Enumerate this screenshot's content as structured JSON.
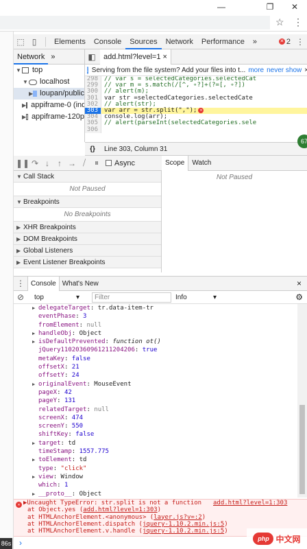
{
  "window": {
    "minimize": "—",
    "restore": "❐",
    "close": "✕"
  },
  "address": {
    "star": "☆",
    "menu": "⋮"
  },
  "devtools": {
    "tabs": [
      "Elements",
      "Console",
      "Sources",
      "Network",
      "Performance"
    ],
    "active_tab": "Sources",
    "more": "»",
    "error_count": "2",
    "menu": "⋮"
  },
  "navigator": {
    "tab": "Network",
    "more": "»",
    "items": [
      {
        "label": "top",
        "arrow": "▼"
      },
      {
        "label": "localhost",
        "arrow": "▼"
      },
      {
        "label": "loupan/public",
        "arrow": "▶"
      },
      {
        "label": "appiframe-0 (ind",
        "arrow": "▶"
      },
      {
        "label": "appiframe-120p",
        "arrow": "▶"
      }
    ]
  },
  "editor": {
    "file_tab": "add.html?level=1",
    "close": "×",
    "info_text": "Serving from the file system? Add your files into t...",
    "info_more": "more",
    "info_never": "never show",
    "info_close": "×",
    "lines": [
      {
        "num": "298",
        "text": "//              var s = selectedCategories.selectedCat",
        "comment": true
      },
      {
        "num": "299",
        "text": "//              var m = s.match(/[^, ∘?]+(?=[, ∘?])",
        "comment": true
      },
      {
        "num": "300",
        "text": "//              alert(m);",
        "comment": true
      },
      {
        "num": "301",
        "text": "              var str =selectedCategories.selectedCate",
        "comment": false
      },
      {
        "num": "302",
        "text": "//              alert(str);",
        "comment": true
      },
      {
        "num": "303",
        "text": "              var arr = str.split(\",\");",
        "comment": false,
        "highlight": true
      },
      {
        "num": "304",
        "text": "              console.log(arr);",
        "comment": false
      },
      {
        "num": "305",
        "text": "//              alert(parseInt(selectedCategories.sele",
        "comment": true
      },
      {
        "num": "306",
        "text": "",
        "comment": false
      }
    ],
    "status": "Line 303, Column 31",
    "braces": "{}",
    "badge": "67"
  },
  "debugger": {
    "async_label": "Async",
    "call_stack": "Call Stack",
    "call_stack_empty": "Not Paused",
    "breakpoints": "Breakpoints",
    "breakpoints_empty": "No Breakpoints",
    "sections": [
      "XHR Breakpoints",
      "DOM Breakpoints",
      "Global Listeners",
      "Event Listener Breakpoints"
    ],
    "scope_tab": "Scope",
    "watch_tab": "Watch",
    "scope_empty": "Not Paused"
  },
  "drawer": {
    "menu": "⋮",
    "tabs": [
      "Console",
      "What's New"
    ],
    "close": "×",
    "context": "top",
    "filter_placeholder": "Filter",
    "level": "Info"
  },
  "console": {
    "props": [
      {
        "tri": "▶",
        "key": "delegateTarget",
        "val": "tr.data-item-tr",
        "kind": "plain"
      },
      {
        "key": "eventPhase",
        "val": "3",
        "kind": "num"
      },
      {
        "key": "fromElement",
        "val": "null",
        "kind": "nul"
      },
      {
        "tri": "▶",
        "key": "handleObj",
        "val": "Object",
        "kind": "plain"
      },
      {
        "tri": "▶",
        "key": "isDefaultPrevented",
        "val": "function ot()",
        "kind": "fn"
      },
      {
        "key": "jQuery11020360961211204206",
        "val": "true",
        "kind": "num"
      },
      {
        "key": "metaKey",
        "val": "false",
        "kind": "num"
      },
      {
        "key": "offsetX",
        "val": "21",
        "kind": "num"
      },
      {
        "key": "offsetY",
        "val": "24",
        "kind": "num"
      },
      {
        "tri": "▶",
        "key": "originalEvent",
        "val": "MouseEvent",
        "kind": "plain"
      },
      {
        "key": "pageX",
        "val": "42",
        "kind": "num"
      },
      {
        "key": "pageY",
        "val": "131",
        "kind": "num"
      },
      {
        "key": "relatedTarget",
        "val": "null",
        "kind": "nul"
      },
      {
        "key": "screenX",
        "val": "474",
        "kind": "num"
      },
      {
        "key": "screenY",
        "val": "550",
        "kind": "num"
      },
      {
        "key": "shiftKey",
        "val": "false",
        "kind": "num"
      },
      {
        "tri": "▶",
        "key": "target",
        "val": "td",
        "kind": "plain"
      },
      {
        "key": "timeStamp",
        "val": "1557.775",
        "kind": "num"
      },
      {
        "tri": "▶",
        "key": "toElement",
        "val": "td",
        "kind": "plain"
      },
      {
        "key": "type",
        "val": "\"click\"",
        "kind": "str"
      },
      {
        "tri": "▶",
        "key": "view",
        "val": "Window",
        "kind": "plain"
      },
      {
        "key": "which",
        "val": "1",
        "kind": "num"
      },
      {
        "tri": "▶",
        "key": "__proto__",
        "val": "Object",
        "kind": "plain"
      }
    ],
    "error": {
      "message": "▶Uncaught TypeError: str.split is not a function",
      "source": "add.html?level=1:303",
      "stack": [
        {
          "text": "at Object.yes (",
          "link": "add.html?level=1:303",
          "end": ")"
        },
        {
          "text": "at HTMLAnchorElement.<anonymous> (",
          "link": "layer.js?v=:2",
          "end": ")"
        },
        {
          "text": "at HTMLAnchorElement.dispatch (",
          "link": "jquery-1.10.2.min.js:5",
          "end": ")"
        },
        {
          "text": "at HTMLAnchorElement.v.handle (",
          "link": "jquery-1.10.2.min.js:5",
          "end": ")"
        }
      ]
    },
    "prompt": "›"
  },
  "left_tag": "86s",
  "watermark": {
    "logo": "php",
    "text": "中文网"
  }
}
